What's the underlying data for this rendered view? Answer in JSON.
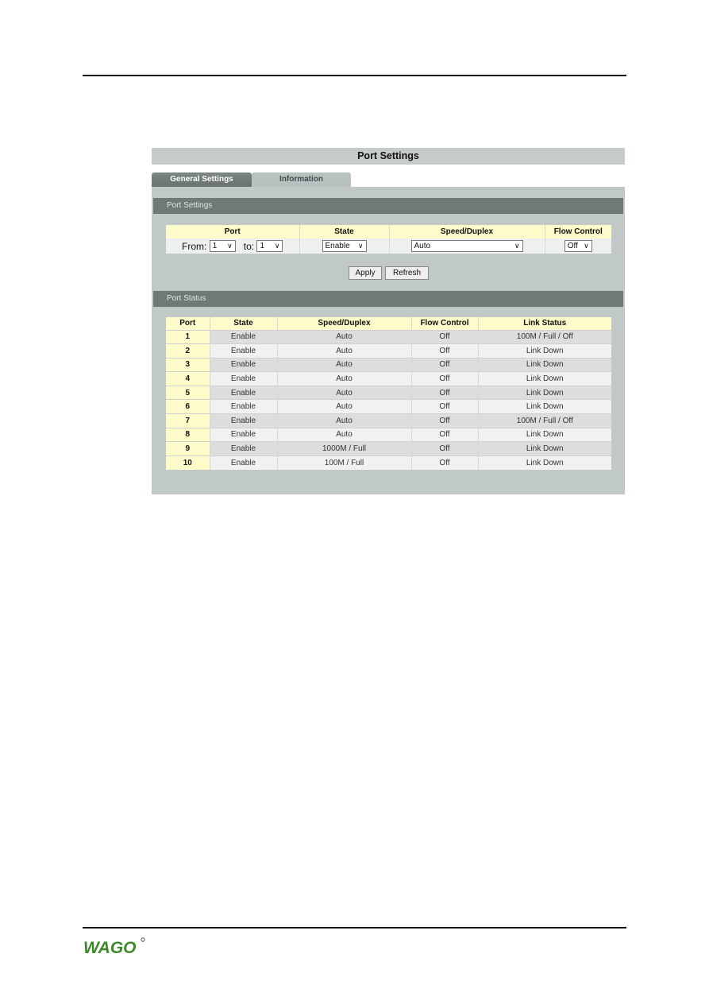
{
  "document": {
    "logo_text": "WAGO",
    "logo_color": "#3b8a2a"
  },
  "page": {
    "title": "Port Settings",
    "tabs": [
      {
        "label": "General Settings",
        "active": true
      },
      {
        "label": "Information",
        "active": false
      }
    ]
  },
  "port_settings": {
    "section_title": "Port Settings",
    "headers": [
      "Port",
      "State",
      "Speed/Duplex",
      "Flow Control"
    ],
    "from_label": "From:",
    "from_value": "1",
    "to_label": "to:",
    "to_value": "1",
    "state_value": "Enable",
    "speed_value": "Auto",
    "flow_value": "Off",
    "apply_label": "Apply",
    "refresh_label": "Refresh"
  },
  "port_status": {
    "section_title": "Port Status",
    "headers": [
      "Port",
      "State",
      "Speed/Duplex",
      "Flow Control",
      "Link Status"
    ],
    "rows": [
      {
        "port": "1",
        "state": "Enable",
        "speed": "Auto",
        "flow": "Off",
        "link": "100M / Full / Off"
      },
      {
        "port": "2",
        "state": "Enable",
        "speed": "Auto",
        "flow": "Off",
        "link": "Link Down"
      },
      {
        "port": "3",
        "state": "Enable",
        "speed": "Auto",
        "flow": "Off",
        "link": "Link Down"
      },
      {
        "port": "4",
        "state": "Enable",
        "speed": "Auto",
        "flow": "Off",
        "link": "Link Down"
      },
      {
        "port": "5",
        "state": "Enable",
        "speed": "Auto",
        "flow": "Off",
        "link": "Link Down"
      },
      {
        "port": "6",
        "state": "Enable",
        "speed": "Auto",
        "flow": "Off",
        "link": "Link Down"
      },
      {
        "port": "7",
        "state": "Enable",
        "speed": "Auto",
        "flow": "Off",
        "link": "100M / Full / Off"
      },
      {
        "port": "8",
        "state": "Enable",
        "speed": "Auto",
        "flow": "Off",
        "link": "Link Down"
      },
      {
        "port": "9",
        "state": "Enable",
        "speed": "1000M / Full",
        "flow": "Off",
        "link": "Link Down"
      },
      {
        "port": "10",
        "state": "Enable",
        "speed": "100M / Full",
        "flow": "Off",
        "link": "Link Down"
      }
    ]
  }
}
